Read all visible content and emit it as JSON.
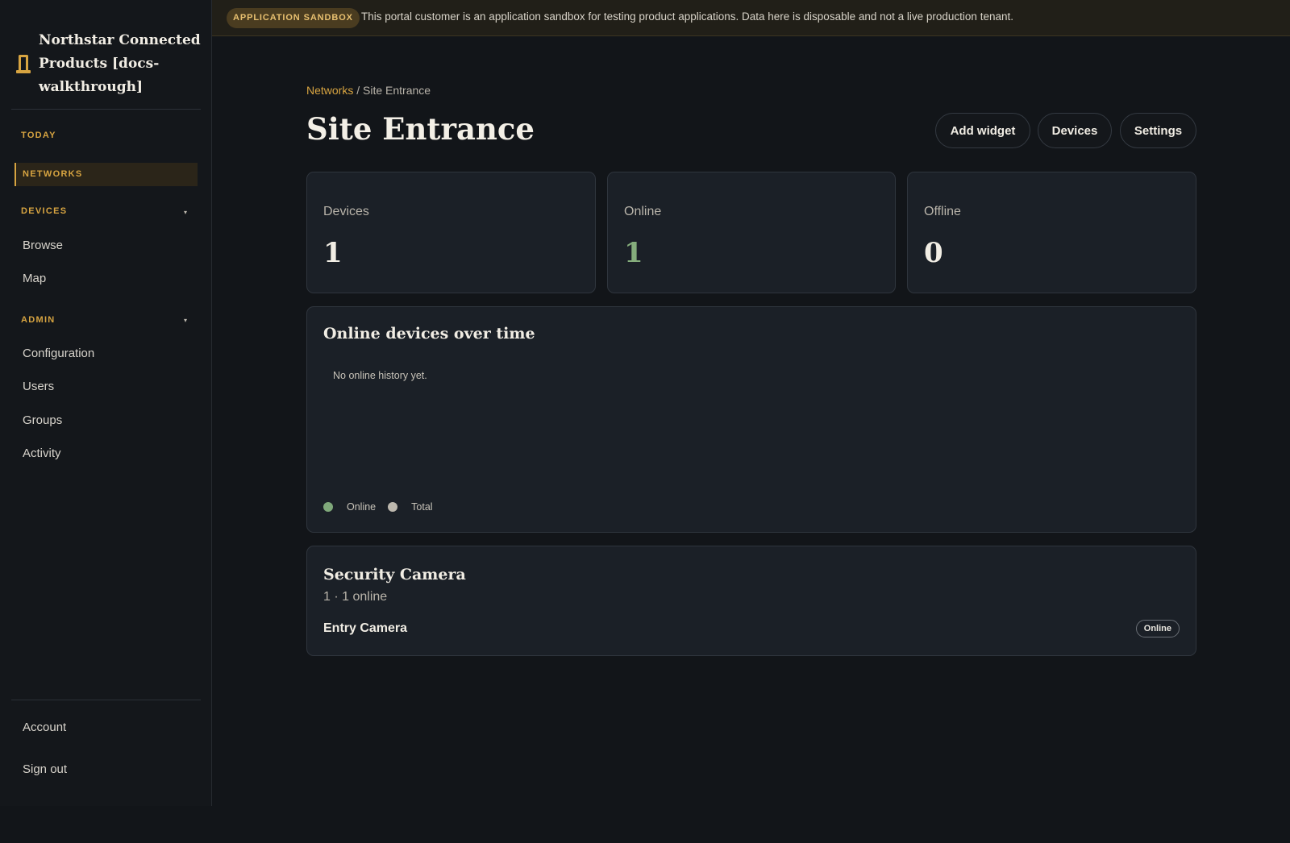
{
  "sidebar": {
    "brand_name": "Northstar Connected Products [docs-walkthrough]",
    "nav": {
      "today": "TODAY",
      "networks": "NETWORKS",
      "devices_section": "DEVICES",
      "devices_caret": "▾",
      "browse": "Browse",
      "map": "Map",
      "admin_section": "ADMIN",
      "admin_caret": "▾",
      "configuration": "Configuration",
      "users": "Users",
      "groups": "Groups",
      "activity": "Activity"
    },
    "footer": {
      "account": "Account",
      "sign_out": "Sign out"
    }
  },
  "banner": {
    "badge": "APPLICATION SANDBOX",
    "text": "This portal customer is an application sandbox for testing product applications. Data here is disposable and not a live production tenant."
  },
  "breadcrumb": {
    "link": "Networks",
    "separator": " / ",
    "current": "Site Entrance"
  },
  "page": {
    "title": "Site Entrance",
    "actions": {
      "add_widget": "Add widget",
      "devices": "Devices",
      "settings": "Settings"
    }
  },
  "stats": [
    {
      "label": "Devices",
      "value": "1"
    },
    {
      "label": "Online",
      "value": "1"
    },
    {
      "label": "Offline",
      "value": "0"
    }
  ],
  "chart": {
    "title": "Online devices over time",
    "empty_message": "No online history yet.",
    "legend": [
      {
        "name": "Online",
        "color": "#7fa87a"
      },
      {
        "name": "Total",
        "color": "#bdb8ae"
      }
    ]
  },
  "device_group": {
    "title": "Security Camera",
    "subtitle": "1 · 1 online",
    "devices": [
      {
        "name": "Entry Camera",
        "status": "Online"
      }
    ]
  },
  "colors": {
    "accent": "#d7a441",
    "online_green": "#85ad7c",
    "background": "#121519"
  },
  "icons": {
    "brand": "network-pole-icon"
  }
}
